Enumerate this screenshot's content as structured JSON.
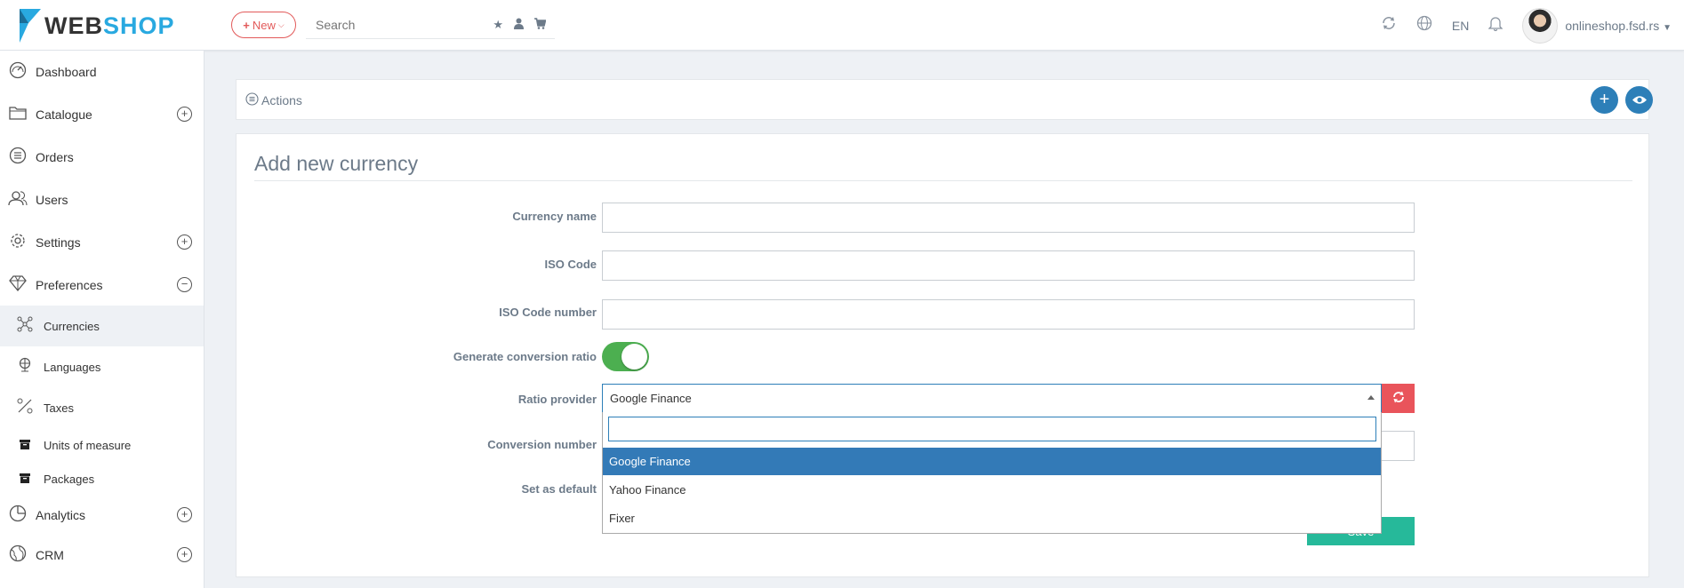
{
  "header": {
    "logo_web": "WEB",
    "logo_shop": "SHOP",
    "new_label": "New",
    "search_placeholder": "Search",
    "language": "EN",
    "user_name": "onlineshop.fsd.rs"
  },
  "sidebar": {
    "items": [
      {
        "label": "Dashboard",
        "icon": "dashboard-icon"
      },
      {
        "label": "Catalogue",
        "icon": "folder-icon",
        "toggle": "+"
      },
      {
        "label": "Orders",
        "icon": "orders-list-icon"
      },
      {
        "label": "Users",
        "icon": "users-icon"
      },
      {
        "label": "Settings",
        "icon": "gear-icon",
        "toggle": "+"
      },
      {
        "label": "Preferences",
        "icon": "diamond-icon",
        "toggle": "−"
      },
      {
        "label": "Analytics",
        "icon": "pie-chart-icon",
        "toggle": "+"
      },
      {
        "label": "CRM",
        "icon": "globe-icon",
        "toggle": "+"
      }
    ],
    "sub_items": [
      {
        "label": "Currencies",
        "icon": "network-icon"
      },
      {
        "label": "Languages",
        "icon": "language-globe-icon"
      },
      {
        "label": "Taxes",
        "icon": "percent-icon"
      },
      {
        "label": "Units of measure",
        "icon": "box-icon"
      },
      {
        "label": "Packages",
        "icon": "box-icon"
      }
    ]
  },
  "actions": {
    "label": "Actions"
  },
  "form": {
    "title": "Add new currency",
    "currency_name_label": "Currency name",
    "iso_code_label": "ISO Code",
    "iso_code_number_label": "ISO Code number",
    "generate_ratio_label": "Generate conversion ratio",
    "ratio_provider_label": "Ratio provider",
    "conversion_number_label": "Conversion number",
    "set_default_label": "Set as default",
    "ratio_provider_value": "Google Finance",
    "provider_options": [
      "Google Finance",
      "Yahoo Finance",
      "Fixer"
    ],
    "save_label": "Save"
  }
}
